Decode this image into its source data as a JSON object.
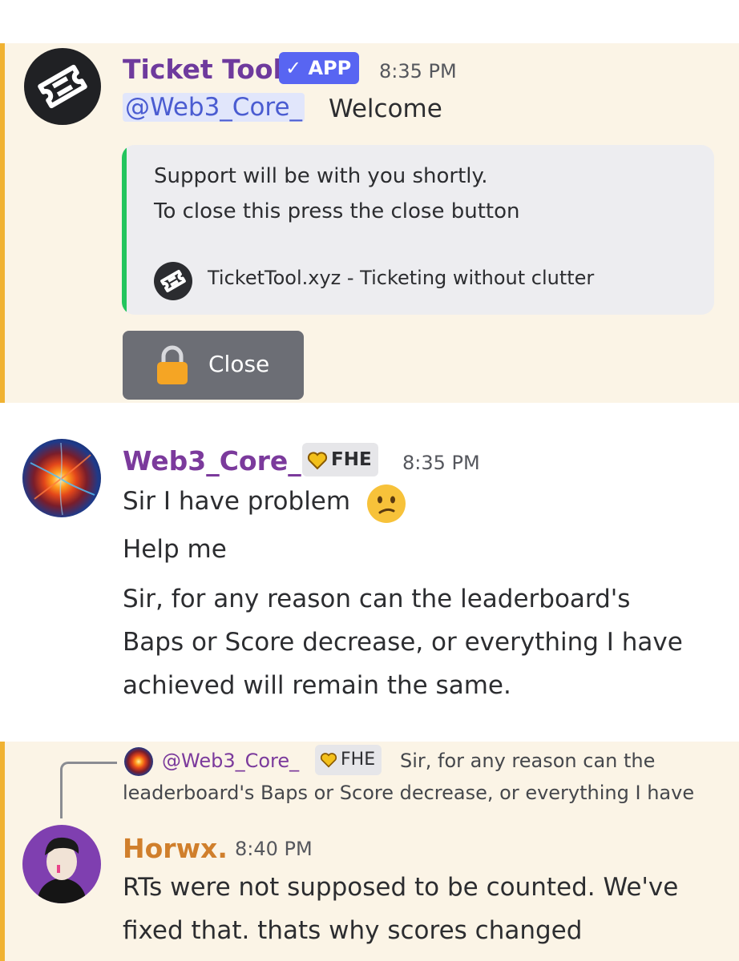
{
  "colors": {
    "highlight_band": "#fbf4e6",
    "highlight_bar": "#f0b232",
    "app_badge": "#5865f2",
    "embed_stripe": "#23c55e",
    "close_button": "#6c6e75",
    "ticket_tool_name": "#6e3a9d",
    "web3_name": "#7b3a9c",
    "horwx_name": "#d07f2c",
    "mention_bg": "#e1e6fb"
  },
  "messages": [
    {
      "author": "Ticket Tool",
      "badge": "APP",
      "badge_check": "✓",
      "time": "8:35 PM",
      "mention": "@Web3_Core_",
      "text": "Welcome",
      "avatar_icon": "ticket-icon",
      "embed": {
        "line1": "Support will be with you shortly.",
        "line2": "To close this press the close button",
        "footer": "TicketTool.xyz - Ticketing without clutter",
        "footer_icon": "ticket-icon"
      },
      "button": {
        "label": "Close",
        "icon": "lock-icon"
      }
    },
    {
      "author": "Web3_Core_",
      "tag": "FHE",
      "tag_icon": "heart-icon",
      "time": "8:35 PM",
      "lines": [
        "Sir I have problem",
        "Help me",
        "Sir, for any reason can the leaderboard's",
        "Baps or Score decrease, or everything I have",
        "achieved will remain the same."
      ],
      "emoji": "confused-face-icon"
    },
    {
      "reply": {
        "mention": "@Web3_Core_",
        "tag": "FHE",
        "text_line1": "Sir, for any reason can the",
        "text_line2": "leaderboard's Baps or Score decrease, or everything I have"
      },
      "author": "Horwx.",
      "time": "8:40 PM",
      "lines": [
        "RTs were not supposed to be counted. We've",
        "fixed that. thats why scores changed"
      ]
    }
  ]
}
